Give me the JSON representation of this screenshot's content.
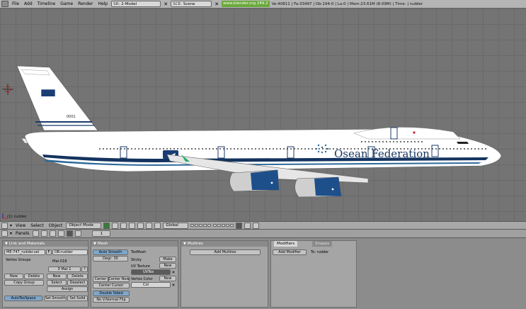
{
  "topbar": {
    "menus": [
      "File",
      "Add",
      "Timeline",
      "Game",
      "Render",
      "Help"
    ],
    "screen_field": {
      "prefix": "SR:",
      "value": "2-Model"
    },
    "scene_field": {
      "prefix": "SCE:",
      "value": "Scene"
    },
    "url": "www.blender.org 249.2",
    "stats": "Ve:40811 | Fa:33497 | Ob:194-0 | La:0  | Mem:23.61M (8.09M) | Time: | rudder"
  },
  "viewport": {
    "label": "(1) rudder",
    "livery_text": "Osean Federation",
    "tail_number": "0001"
  },
  "view_header": {
    "menus": [
      "View",
      "Select",
      "Object"
    ],
    "mode": "Object Mode",
    "orientation": "Global"
  },
  "buttons_header": {
    "panels_label": "Panels",
    "frame": "1"
  },
  "link_materials": {
    "title": "Link and Materials",
    "mesh_field": "ME:747_rudder.sel",
    "ob_field": "OB:rudder",
    "vertex_groups": "Vertex Groups",
    "material_name": "Mat.018",
    "mat_index": "3 Mat 1",
    "question": "?",
    "new": "New",
    "delete": "Delete",
    "copy_group": "Copy Group",
    "select": "Select",
    "deselect": "Deselect",
    "assign": "Assign",
    "autotexspace": "AutoTexSpace",
    "set_smooth": "Set Smooth",
    "set_solid": "Set Solid"
  },
  "mesh": {
    "title": "Mesh",
    "auto_smooth": "Auto Smooth",
    "degr": "Degr: 30",
    "texmesh": "TexMesh",
    "sticky": "Sticky",
    "make": "Make",
    "uv_texture": "UV Texture",
    "new": "New",
    "uvtex": "UVTex",
    "vertex_color": "Vertex Color",
    "col": "Col",
    "center_new": "Center New",
    "center": "Center",
    "center_cursor": "Center Cursor",
    "double_sided": "Double Sided",
    "no_v_normal_flip": "No V.Normal Flip"
  },
  "multires": {
    "title": "Multires",
    "add_multires": "Add Multires"
  },
  "modifiers": {
    "tab_modifiers": "Modifiers",
    "tab_shapes": "Shapes",
    "add_modifier": "Add Modifier",
    "to": "To: rudder"
  }
}
